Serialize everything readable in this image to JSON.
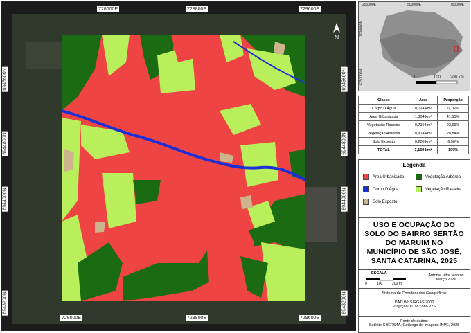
{
  "map": {
    "coords_top": [
      "728000E",
      "728800E",
      "729600E"
    ],
    "coords_bottom": [
      "728000E",
      "728800E",
      "729600E"
    ],
    "coords_left": [
      "6945600N",
      "6944800N",
      "6944000N",
      "6943200N"
    ],
    "coords_right": [
      "6945600N",
      "6944800N",
      "6944000N",
      "6943200N"
    ],
    "north_label": "N"
  },
  "inset": {
    "x_ticks": [
      "250000E",
      "500000E",
      "750000E"
    ],
    "y_ticks": [
      "7000000N",
      "6750000N"
    ],
    "scale_labels": [
      "0",
      "100",
      "200 km"
    ]
  },
  "table": {
    "headers": [
      "Classe",
      "Área",
      "Proporção"
    ],
    "rows": [
      [
        "Corpo D'Água",
        "0,024 km²",
        "0,76%"
      ],
      [
        "Área Urbanizada",
        "1,304 km²",
        "41,15%"
      ],
      [
        "Vegetação Rasteira",
        "0,719 km²",
        "22,69%"
      ],
      [
        "Vegetação Arbórea",
        "0,914 km²",
        "28,84%"
      ],
      [
        "Solo Exposto",
        "0,208 km²",
        "6,56%"
      ]
    ],
    "total": [
      "TOTAL",
      "3,169 km²",
      "100%"
    ]
  },
  "legend": {
    "title": "Legenda",
    "items": [
      {
        "label": "Área Urbanizada",
        "color": "#ee4444"
      },
      {
        "label": "Vegetação Arbórea",
        "color": "#1a6b12"
      },
      {
        "label": "Corpo D'Água",
        "color": "#1a2fd6"
      },
      {
        "label": "Vegetação Rasteira",
        "color": "#b8ef5a"
      },
      {
        "label": "Solo Exposto",
        "color": "#cdb48c"
      }
    ]
  },
  "title_lines": [
    "USO E OCUPAÇÃO DO",
    "SOLO DO BAIRRO SERTÃO",
    "DO MARUIM NO",
    "MUNICÍPIO DE SÃO JOSÉ,",
    "SANTA CATARINA, 2025"
  ],
  "scale": {
    "title": "ESCALA",
    "labels": [
      "0",
      "100",
      "200 m"
    ]
  },
  "author": {
    "line1": "Autoria: Vitor Marcos",
    "line2": "Março/2026"
  },
  "crs": {
    "line1": "Sistema de Coordenadas Geográficas",
    "line2": "DATUM: SIRGAS 2000",
    "line3": "Projeção: UTM Zona 22S"
  },
  "source": {
    "line1": "Fonte de dados:",
    "line2": "Satélite CBERS4A, Catálogo de Imagens INPE, 2025"
  }
}
